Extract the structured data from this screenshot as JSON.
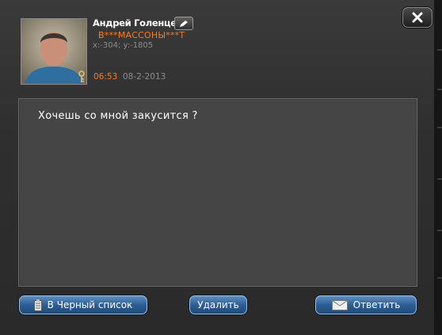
{
  "sender": {
    "name": "Андрей Голенцев",
    "guild": "В***МАССОНЫ***Т",
    "coords": "x:-304; y:-1805",
    "time": "06:53",
    "date": "08-2-2013"
  },
  "message": {
    "text": "Хочешь со мной закусится ?"
  },
  "buttons": {
    "blacklist_label": "В Черный список",
    "delete_label": "Удалить",
    "reply_label": "Ответить"
  },
  "icons": {
    "close": "close-icon",
    "edit": "pencil-icon",
    "blacklist": "notepad-icon",
    "reply": "envelope-icon",
    "profession": "sword-key-icon"
  },
  "colors": {
    "accent": "#ff7a1a",
    "button": "#2d5f95",
    "panel": "#454545"
  }
}
